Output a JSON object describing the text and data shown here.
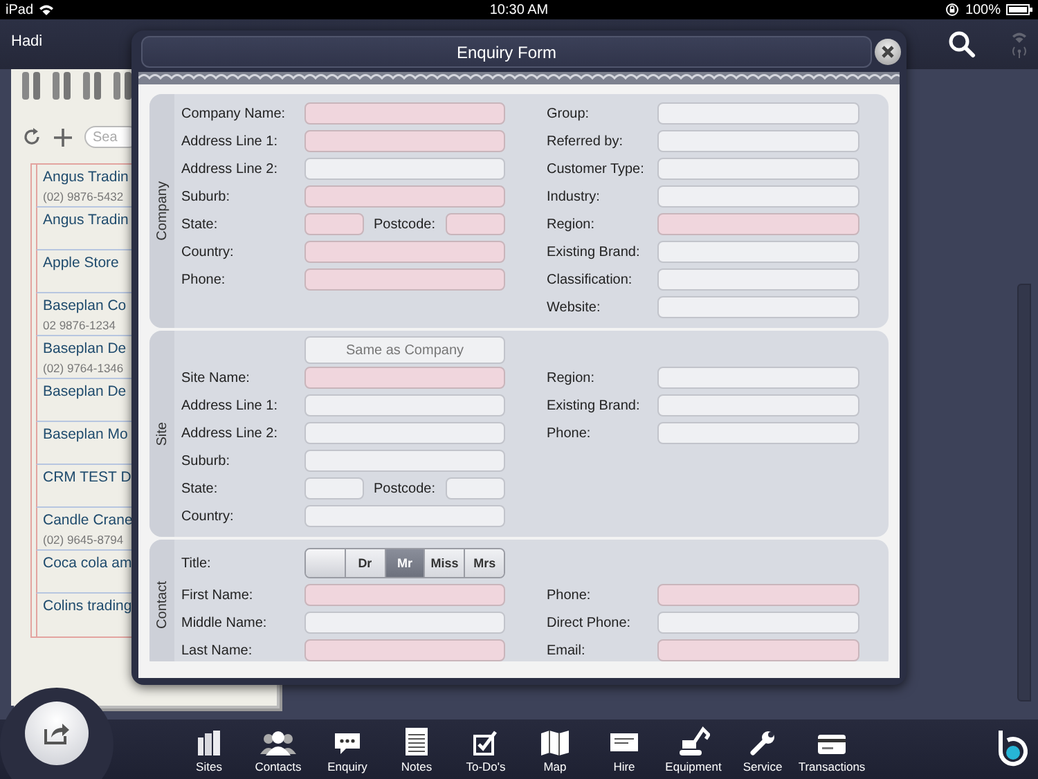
{
  "status_bar": {
    "device": "iPad",
    "time": "10:30 AM",
    "battery": "100%"
  },
  "header": {
    "user": "Hadi"
  },
  "notebook": {
    "search": {
      "placeholder": "Sea"
    },
    "rows": [
      {
        "name": "Angus Tradin",
        "phone": "(02) 9876-5432"
      },
      {
        "name": "Angus Tradin"
      },
      {
        "name": "Apple Store"
      },
      {
        "name": "Baseplan Co",
        "phone": "02 9876-1234"
      },
      {
        "name": "Baseplan De",
        "phone": "(02) 9764-1346"
      },
      {
        "name": "Baseplan De"
      },
      {
        "name": "Baseplan Mo"
      },
      {
        "name": "CRM TEST D"
      },
      {
        "name": "Candle Crane",
        "phone": "(02) 9645-8794"
      },
      {
        "name": "Coca cola am"
      },
      {
        "name": "Colins trading"
      }
    ]
  },
  "form": {
    "title": "Enquiry Form",
    "sections": [
      {
        "label": "Company",
        "rows": [
          {
            "left": {
              "kind": "field",
              "label": "Company Name:",
              "required": true
            },
            "right": {
              "label": "Group:",
              "required": false
            }
          },
          {
            "left": {
              "kind": "field",
              "label": "Address Line 1:",
              "required": true
            },
            "right": {
              "label": "Referred by:",
              "required": false
            }
          },
          {
            "left": {
              "kind": "field",
              "label": "Address Line 2:",
              "required": false
            },
            "right": {
              "label": "Customer Type:",
              "required": false
            }
          },
          {
            "left": {
              "kind": "field",
              "label": "Suburb:",
              "required": true
            },
            "right": {
              "label": "Industry:",
              "required": false
            }
          },
          {
            "left": {
              "kind": "split",
              "label": "State:",
              "required": true,
              "label2": "Postcode:",
              "required2": true
            },
            "right": {
              "label": "Region:",
              "required": true
            }
          },
          {
            "left": {
              "kind": "field",
              "label": "Country:",
              "required": true
            },
            "right": {
              "label": "Existing Brand:",
              "required": false
            }
          },
          {
            "left": {
              "kind": "field",
              "label": "Phone:",
              "required": true
            },
            "right": {
              "label": "Classification:",
              "required": false
            }
          },
          {
            "right": {
              "label": "Website:",
              "required": false
            }
          }
        ]
      },
      {
        "label": "Site",
        "rows": [
          {
            "left": {
              "kind": "button",
              "label": "Same as Company"
            }
          },
          {
            "left": {
              "kind": "field",
              "label": "Site Name:",
              "required": true
            },
            "right": {
              "label": "Region:",
              "required": false
            }
          },
          {
            "left": {
              "kind": "field",
              "label": "Address Line 1:",
              "required": false
            },
            "right": {
              "label": "Existing Brand:",
              "required": false
            }
          },
          {
            "left": {
              "kind": "field",
              "label": "Address Line 2:",
              "required": false
            },
            "right": {
              "label": "Phone:",
              "required": false
            }
          },
          {
            "left": {
              "kind": "field",
              "label": "Suburb:",
              "required": false
            }
          },
          {
            "left": {
              "kind": "split",
              "label": "State:",
              "required": false,
              "label2": "Postcode:",
              "required2": false
            }
          },
          {
            "left": {
              "kind": "field",
              "label": "Country:",
              "required": false
            }
          }
        ]
      },
      {
        "label": "Contact",
        "rows": [
          {
            "left": {
              "kind": "segmented",
              "label": "Title:",
              "options": [
                {
                  "label": "Dr",
                  "selected": false
                },
                {
                  "label": "Mr",
                  "selected": true
                },
                {
                  "label": "Miss",
                  "selected": false
                },
                {
                  "label": "Mrs",
                  "selected": false
                }
              ]
            }
          },
          {
            "left": {
              "kind": "field",
              "label": "First Name:",
              "required": true
            },
            "right": {
              "label": "Phone:",
              "required": true
            }
          },
          {
            "left": {
              "kind": "field",
              "label": "Middle Name:",
              "required": false
            },
            "right": {
              "label": "Direct Phone:",
              "required": false
            }
          },
          {
            "left": {
              "kind": "field",
              "label": "Last Name:",
              "required": true
            },
            "right": {
              "label": "Email:",
              "required": true
            }
          }
        ]
      }
    ]
  },
  "tabs": [
    {
      "label": "Sites"
    },
    {
      "label": "Contacts"
    },
    {
      "label": "Enquiry"
    },
    {
      "label": "Notes"
    },
    {
      "label": "To-Do's"
    },
    {
      "label": "Map"
    },
    {
      "label": "Hire"
    },
    {
      "label": "Equipment"
    },
    {
      "label": "Service"
    },
    {
      "label": "Transactions"
    }
  ]
}
